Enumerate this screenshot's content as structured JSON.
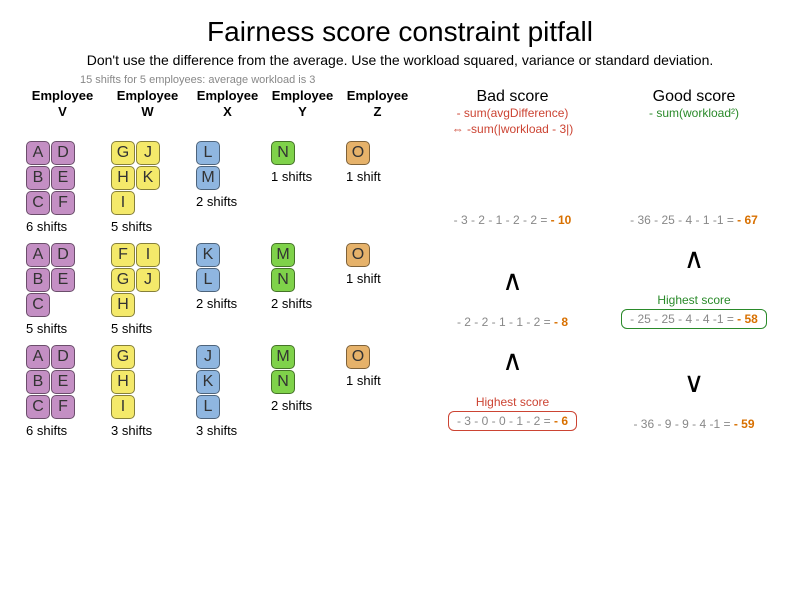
{
  "title": "Fairness score constraint pitfall",
  "subtitle": "Don't use the difference from the average. Use the workload squared, variance or standard deviation.",
  "avg_note": "15 shifts for  5 employees: average workload is 3",
  "employees": {
    "V": "Employee V",
    "W": "Employee W",
    "X": "Employee X",
    "Y": "Employee Y",
    "Z": "Employee Z"
  },
  "bad_score_header": "Bad score",
  "bad_score_formula1": "- sum(avgDifference)",
  "bad_score_formula2": "⇔ -sum(|workload - 3|)",
  "good_score_header": "Good score",
  "good_score_formula": "- sum(workload²)",
  "highest_label": "Highest score",
  "rows": [
    {
      "V": {
        "tiles": [
          "A",
          "B",
          "C",
          "D",
          "E",
          "F"
        ],
        "label": "6 shifts"
      },
      "W": {
        "tiles": [
          "G",
          "H",
          "I",
          "J",
          "K"
        ],
        "label": "5 shifts"
      },
      "X": {
        "tiles": [
          "L",
          "M"
        ],
        "label": "2 shifts"
      },
      "Y": {
        "tiles": [
          "N"
        ],
        "label": "1 shifts"
      },
      "Z": {
        "tiles": [
          "O"
        ],
        "label": "1 shift"
      },
      "bad": {
        "expr": "- 3 - 2 - 1 - 2 - 2 = ",
        "result": "- 10"
      },
      "good": {
        "expr": "- 36 - 25 - 4 - 1 -1 = ",
        "result": "- 67"
      }
    },
    {
      "V": {
        "tiles": [
          "A",
          "B",
          "C",
          "D",
          "E"
        ],
        "label": "5 shifts"
      },
      "W": {
        "tiles": [
          "F",
          "G",
          "H",
          "I",
          "J"
        ],
        "label": "5 shifts"
      },
      "X": {
        "tiles": [
          "K",
          "L"
        ],
        "label": "2 shifts"
      },
      "Y": {
        "tiles": [
          "M",
          "N"
        ],
        "label": "2 shifts"
      },
      "Z": {
        "tiles": [
          "O"
        ],
        "label": "1 shift"
      },
      "bad": {
        "expr": "- 2 - 2 - 1 - 1 - 2 = ",
        "result": "- 8",
        "carrot": "∧"
      },
      "good": {
        "expr": "- 25 - 25 - 4 - 4 -1 = ",
        "result": "- 58",
        "carrot": "∧",
        "highest": true
      }
    },
    {
      "V": {
        "tiles": [
          "A",
          "B",
          "C",
          "D",
          "E",
          "F"
        ],
        "label": "6 shifts"
      },
      "W": {
        "tiles": [
          "G",
          "H",
          "I"
        ],
        "label": "3 shifts"
      },
      "X": {
        "tiles": [
          "J",
          "K",
          "L"
        ],
        "label": "3 shifts"
      },
      "Y": {
        "tiles": [
          "M",
          "N"
        ],
        "label": "2 shifts"
      },
      "Z": {
        "tiles": [
          "O"
        ],
        "label": "1 shift"
      },
      "bad": {
        "expr": "- 3 - 0 - 0 - 1 - 2 = ",
        "result": "- 6",
        "carrot": "∧",
        "highest": true
      },
      "good": {
        "expr": "- 36 - 9 - 9 - 4 -1 = ",
        "result": "- 59",
        "carrot": "∨"
      }
    }
  ],
  "colors": {
    "V": "c-purple",
    "W": "c-yellow",
    "X": "c-blue",
    "Y": "c-green",
    "Z": "c-orange"
  }
}
